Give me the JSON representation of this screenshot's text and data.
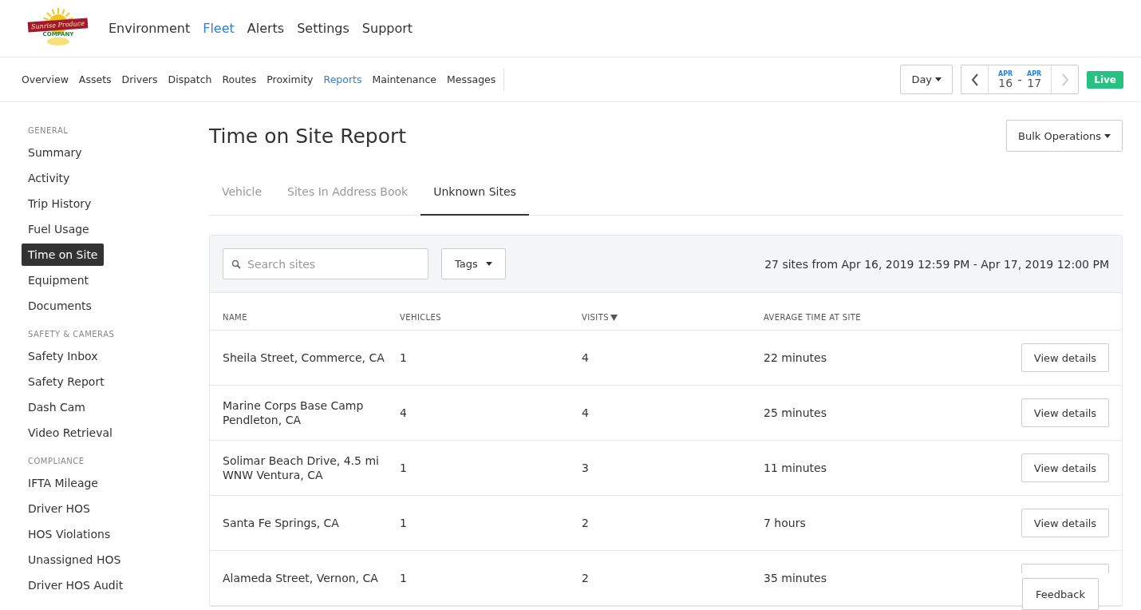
{
  "logo": {
    "name": "Sunrise Produce",
    "sub": "COMPANY"
  },
  "top_nav": [
    {
      "label": "Environment",
      "selected": false
    },
    {
      "label": "Fleet",
      "selected": true
    },
    {
      "label": "Alerts",
      "selected": false
    },
    {
      "label": "Settings",
      "selected": false
    },
    {
      "label": "Support",
      "selected": false
    }
  ],
  "sub_nav": [
    {
      "label": "Overview",
      "selected": false
    },
    {
      "label": "Assets",
      "selected": false
    },
    {
      "label": "Drivers",
      "selected": false
    },
    {
      "label": "Dispatch",
      "selected": false
    },
    {
      "label": "Routes",
      "selected": false
    },
    {
      "label": "Proximity",
      "selected": false
    },
    {
      "label": "Reports",
      "selected": true
    },
    {
      "label": "Maintenance",
      "selected": false
    },
    {
      "label": "Messages",
      "selected": false
    }
  ],
  "range_select": "Day",
  "date_range": {
    "start_month": "APR",
    "start_day": "16",
    "separator": "-",
    "end_month": "APR",
    "end_day": "17",
    "next_disabled": true
  },
  "live_badge": "Live",
  "sidebar": [
    {
      "heading": "GENERAL",
      "items": [
        {
          "label": "Summary",
          "selected": false
        },
        {
          "label": "Activity",
          "selected": false
        },
        {
          "label": "Trip History",
          "selected": false
        },
        {
          "label": "Fuel Usage",
          "selected": false
        },
        {
          "label": "Time on Site",
          "selected": true
        },
        {
          "label": "Equipment",
          "selected": false
        },
        {
          "label": "Documents",
          "selected": false
        }
      ]
    },
    {
      "heading": "SAFETY & CAMERAS",
      "items": [
        {
          "label": "Safety Inbox",
          "selected": false
        },
        {
          "label": "Safety Report",
          "selected": false
        },
        {
          "label": "Dash Cam",
          "selected": false
        },
        {
          "label": "Video Retrieval",
          "selected": false
        }
      ]
    },
    {
      "heading": "COMPLIANCE",
      "items": [
        {
          "label": "IFTA Mileage",
          "selected": false
        },
        {
          "label": "Driver HOS",
          "selected": false
        },
        {
          "label": "HOS Violations",
          "selected": false
        },
        {
          "label": "Unassigned HOS",
          "selected": false
        },
        {
          "label": "Driver HOS Audit",
          "selected": false
        }
      ]
    }
  ],
  "page_title": "Time on Site Report",
  "bulk_button": "Bulk Operations",
  "tabs": [
    {
      "label": "Vehicle",
      "selected": false
    },
    {
      "label": "Sites In Address Book",
      "selected": false
    },
    {
      "label": "Unknown Sites",
      "selected": true
    }
  ],
  "search": {
    "placeholder": "Search sites"
  },
  "tags_button": "Tags",
  "summary": "27 sites from Apr 16, 2019 12:59 PM - Apr 17, 2019 12:00 PM",
  "table": {
    "columns": [
      {
        "label": "NAME",
        "sorted": false
      },
      {
        "label": "VEHICLES",
        "sorted": false
      },
      {
        "label": "VISITS",
        "sorted": true
      },
      {
        "label": "AVERAGE TIME AT SITE",
        "sorted": false
      }
    ],
    "rows": [
      {
        "name": "Sheila Street, Commerce, CA",
        "vehicles": "1",
        "visits": "4",
        "avg": "22 minutes",
        "action": "View details"
      },
      {
        "name": "Marine Corps Base Camp Pendleton, CA",
        "vehicles": "4",
        "visits": "4",
        "avg": "25 minutes",
        "action": "View details"
      },
      {
        "name": "Solimar Beach Drive, 4.5 mi WNW Ventura, CA",
        "vehicles": "1",
        "visits": "3",
        "avg": "11 minutes",
        "action": "View details"
      },
      {
        "name": "Santa Fe Springs, CA",
        "vehicles": "1",
        "visits": "2",
        "avg": "7 hours",
        "action": "View details"
      },
      {
        "name": "Alameda Street, Vernon, CA",
        "vehicles": "1",
        "visits": "2",
        "avg": "35 minutes"
      }
    ]
  },
  "feedback_button": "Feedback"
}
